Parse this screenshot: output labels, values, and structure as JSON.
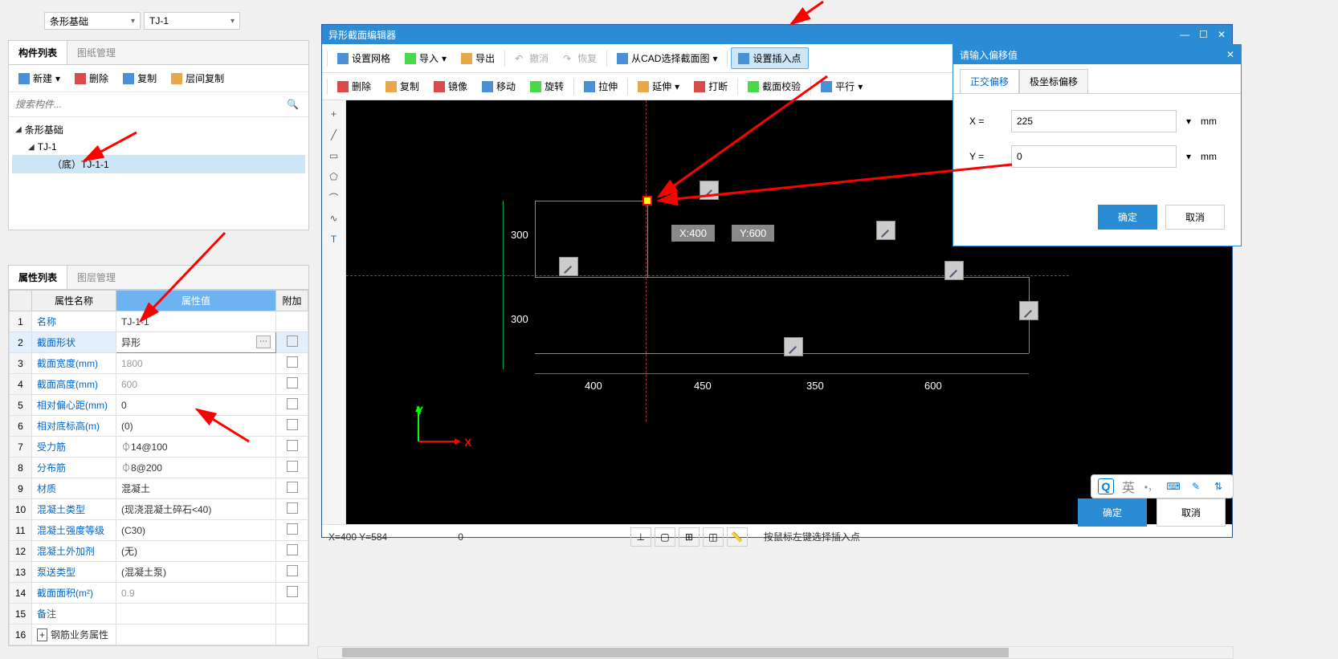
{
  "top_dropdowns": {
    "d1": "条形基础",
    "d2": "TJ-1"
  },
  "left_panel": {
    "tabs": {
      "active": "构件列表",
      "inactive": "图纸管理"
    },
    "toolbar": {
      "new": "新建",
      "delete": "删除",
      "copy": "复制",
      "layer_copy": "层间复制"
    },
    "search_placeholder": "搜索构件...",
    "tree": {
      "root": "条形基础",
      "child": "TJ-1",
      "leaf": "（底）TJ-1-1"
    }
  },
  "prop_panel": {
    "tabs": {
      "active": "属性列表",
      "inactive": "图层管理"
    },
    "headers": {
      "name": "属性名称",
      "value": "属性值",
      "extra": "附加"
    },
    "rows": [
      {
        "n": "1",
        "name": "名称",
        "val": "TJ-1-1",
        "link": true
      },
      {
        "n": "2",
        "name": "截面形状",
        "val": "异形",
        "link": true,
        "sel": true,
        "btn": true
      },
      {
        "n": "3",
        "name": "截面宽度(mm)",
        "val": "1800",
        "link": true,
        "gray": true
      },
      {
        "n": "4",
        "name": "截面高度(mm)",
        "val": "600",
        "link": true,
        "gray": true
      },
      {
        "n": "5",
        "name": "相对偏心距(mm)",
        "val": "0",
        "link": true
      },
      {
        "n": "6",
        "name": "相对底标高(m)",
        "val": "(0)",
        "link": true
      },
      {
        "n": "7",
        "name": "受力筋",
        "val": "⏀14@100",
        "link": true
      },
      {
        "n": "8",
        "name": "分布筋",
        "val": "⏀8@200",
        "link": true
      },
      {
        "n": "9",
        "name": "材质",
        "val": "混凝土",
        "link": true
      },
      {
        "n": "10",
        "name": "混凝土类型",
        "val": "(现浇混凝土碎石<40)",
        "link": true
      },
      {
        "n": "11",
        "name": "混凝土强度等级",
        "val": "(C30)",
        "link": true
      },
      {
        "n": "12",
        "name": "混凝土外加剂",
        "val": "(无)",
        "link": true
      },
      {
        "n": "13",
        "name": "泵送类型",
        "val": "(混凝土泵)",
        "link": true
      },
      {
        "n": "14",
        "name": "截面面积(m²)",
        "val": "0.9",
        "link": true,
        "gray": true
      },
      {
        "n": "15",
        "name": "备注",
        "val": "",
        "link": true
      },
      {
        "n": "16",
        "name": "钢筋业务属性",
        "val": "",
        "expand": true
      }
    ]
  },
  "editor": {
    "title": "异形截面编辑器",
    "toolbar1": {
      "grid": "设置网格",
      "import": "导入",
      "export": "导出",
      "undo": "撤消",
      "redo": "恢复",
      "cad": "从CAD选择截面图",
      "insert": "设置插入点"
    },
    "toolbar2": {
      "delete": "删除",
      "copy": "复制",
      "mirror": "镜像",
      "move": "移动",
      "rotate": "旋转",
      "stretch": "拉伸",
      "extend": "延伸",
      "break": "打断",
      "check": "截面校验",
      "parallel": "平行"
    },
    "canvas": {
      "dim_v1": "300",
      "dim_v2": "300",
      "dim_h1": "400",
      "dim_h2": "450",
      "dim_h3": "350",
      "dim_h4": "600",
      "coord_x": "X:400",
      "coord_y": "Y:600",
      "axis_x": "X",
      "axis_y": "Y"
    },
    "status": {
      "coords": "X=400 Y=584",
      "zero": "0",
      "hint": "按鼠标左键选择插入点"
    }
  },
  "dialog": {
    "title": "请输入偏移值",
    "tabs": {
      "active": "正交偏移",
      "inactive": "极坐标偏移"
    },
    "x_label": "X =",
    "x_val": "225",
    "x_unit": "mm",
    "y_label": "Y =",
    "y_val": "0",
    "y_unit": "mm",
    "ok": "确定",
    "cancel": "取消"
  },
  "bottom": {
    "ok": "确定",
    "cancel": "取消"
  },
  "ime": {
    "lang": "英"
  }
}
